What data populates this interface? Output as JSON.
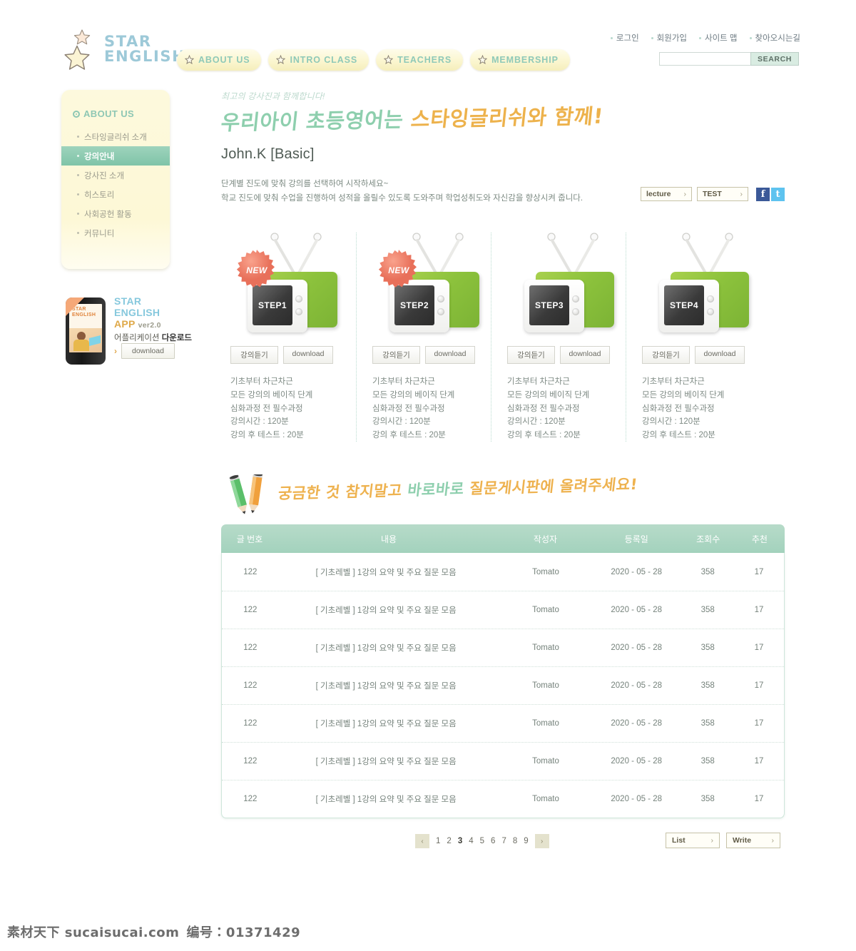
{
  "site": {
    "logo_line1": "STAR",
    "logo_line2": "ENGLISH"
  },
  "gnb": [
    {
      "label": "ABOUT US"
    },
    {
      "label": "INTRO CLASS"
    },
    {
      "label": "TEACHERS"
    },
    {
      "label": "MEMBERSHIP"
    }
  ],
  "util": [
    {
      "label": "로그인"
    },
    {
      "label": "회원가입"
    },
    {
      "label": "사이트 맵"
    },
    {
      "label": "찾아오시는길"
    }
  ],
  "search": {
    "value": "",
    "placeholder": "",
    "button": "SEARCH"
  },
  "sidebar": {
    "title": "ABOUT US",
    "items": [
      {
        "label": "스타잉글리쉬 소개",
        "active": false
      },
      {
        "label": "강의안내",
        "active": true
      },
      {
        "label": "강사진 소개",
        "active": false
      },
      {
        "label": "히스토리",
        "active": false
      },
      {
        "label": "사회공헌 활동",
        "active": false
      },
      {
        "label": "커뮤니티",
        "active": false
      }
    ]
  },
  "app_banner": {
    "phone_label_1": "STAR",
    "phone_label_2": "ENGLISH",
    "title_1": "STAR",
    "title_2": "ENGLISH",
    "title_3": "APP",
    "version": "ver2.0",
    "subtitle": "어플리케이션 다운로드",
    "download_label": "download"
  },
  "hero": {
    "eyebrow": "최고의 강사진과 함께합니다!",
    "headline_green": "우리아이 초등영어는",
    "headline_orange": "스타잉글리쉬와 함께!",
    "subtitle": "John.K [Basic]",
    "desc_line1": "단계별 진도에 맞춰 강의를 선택하여 시작하세요~",
    "desc_line2": "학교 진도에 맞춰 수업을 진행하여 성적을 올릴수 있도록 도와주며 학업성취도와 자신감을 향상시켜 줍니다.",
    "btn_lecture": "lecture",
    "btn_test": "TEST",
    "arrow": "›",
    "sns_facebook": "f",
    "sns_twitter": "t"
  },
  "steps": [
    {
      "screen_label": "STEP1",
      "badge": "NEW",
      "has_badge": true,
      "btn_listen": "강의듣기",
      "btn_download": "download",
      "lines": [
        "기초부터 차근차근",
        "모든 강의의 베이직 단계",
        "심화과정 전 필수과정",
        "강의시간 : 120분",
        "강의 후 테스트  : 20분"
      ]
    },
    {
      "screen_label": "STEP2",
      "badge": "NEW",
      "has_badge": true,
      "btn_listen": "강의듣기",
      "btn_download": "download",
      "lines": [
        "기초부터 차근차근",
        "모든 강의의 베이직 단계",
        "심화과정 전 필수과정",
        "강의시간 : 120분",
        "강의 후 테스트  : 20분"
      ]
    },
    {
      "screen_label": "STEP3",
      "badge": "",
      "has_badge": false,
      "btn_listen": "강의듣기",
      "btn_download": "download",
      "lines": [
        "기초부터 차근차근",
        "모든 강의의 베이직 단계",
        "심화과정 전 필수과정",
        "강의시간 : 120분",
        "강의 후 테스트  : 20분"
      ]
    },
    {
      "screen_label": "STEP4",
      "badge": "",
      "has_badge": false,
      "btn_listen": "강의듣기",
      "btn_download": "download",
      "lines": [
        "기초부터 차근차근",
        "모든 강의의 베이직 단계",
        "심화과정 전 필수과정",
        "강의시간 : 120분",
        "강의 후 테스트  : 20분"
      ]
    }
  ],
  "board_heading": {
    "text_orange_1": "궁금한 것 참지말고",
    "text_green": "바로바로",
    "text_orange_2": "질문게시판에 올려주세요!"
  },
  "board": {
    "columns": [
      "글 번호",
      "내용",
      "작성자",
      "등록일",
      "조회수",
      "추천"
    ],
    "rows": [
      {
        "no": "122",
        "title": "[ 기초레벨 ]  1강의 요약 및 주요 질문 모음",
        "author": "Tomato",
        "date": "2020 - 05 - 28",
        "hits": "358",
        "rec": "17"
      },
      {
        "no": "122",
        "title": "[ 기초레벨 ]  1강의 요약 및 주요 질문 모음",
        "author": "Tomato",
        "date": "2020 - 05 - 28",
        "hits": "358",
        "rec": "17"
      },
      {
        "no": "122",
        "title": "[ 기초레벨 ]  1강의 요약 및 주요 질문 모음",
        "author": "Tomato",
        "date": "2020 - 05 - 28",
        "hits": "358",
        "rec": "17"
      },
      {
        "no": "122",
        "title": "[ 기초레벨 ]  1강의 요약 및 주요 질문 모음",
        "author": "Tomato",
        "date": "2020 - 05 - 28",
        "hits": "358",
        "rec": "17"
      },
      {
        "no": "122",
        "title": "[ 기초레벨 ]  1강의 요약 및 주요 질문 모음",
        "author": "Tomato",
        "date": "2020 - 05 - 28",
        "hits": "358",
        "rec": "17"
      },
      {
        "no": "122",
        "title": "[ 기초레벨 ]  1강의 요약 및 주요 질문 모음",
        "author": "Tomato",
        "date": "2020 - 05 - 28",
        "hits": "358",
        "rec": "17"
      },
      {
        "no": "122",
        "title": "[ 기초레벨 ]  1강의 요약 및 주요 질문 모음",
        "author": "Tomato",
        "date": "2020 - 05 - 28",
        "hits": "358",
        "rec": "17"
      }
    ]
  },
  "paging": {
    "prev": "‹",
    "next": "›",
    "pages": [
      "1",
      "2",
      "3",
      "4",
      "5",
      "6",
      "7",
      "8",
      "9"
    ],
    "current": "3",
    "btn_list": "List",
    "btn_write": "Write",
    "arrow": "›"
  },
  "watermark": {
    "site": "素材天下 sucaisucai.com",
    "code": "编号：01371429"
  },
  "colors": {
    "brand_green": "#8ecfae",
    "brand_orange": "#edb24c",
    "logo_blue": "#9dc9d8",
    "nav_cream": "#fbf6d0",
    "lnb_yellow": "#fdf8d6",
    "table_header": "#a3d2bd",
    "facebook": "#3b5998",
    "twitter": "#5ec3ef"
  }
}
